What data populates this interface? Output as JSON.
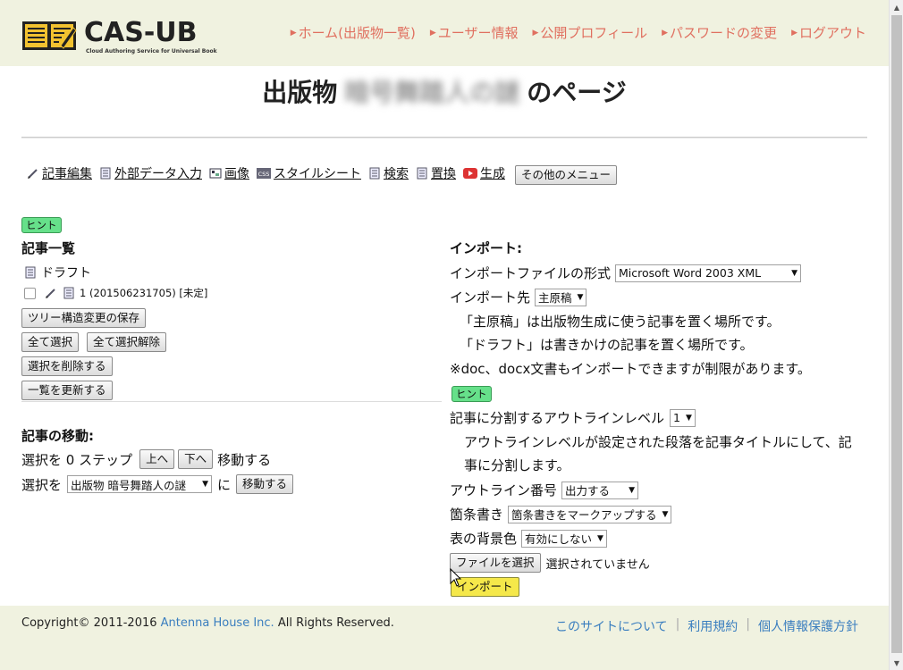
{
  "header": {
    "logo_title": "CAS-UB",
    "logo_subtitle": "Cloud Authoring Service for Universal Book",
    "nav": [
      {
        "label": "ホーム(出版物一覧)"
      },
      {
        "label": "ユーザー情報"
      },
      {
        "label": "公開プロフィール"
      },
      {
        "label": "パスワードの変更"
      },
      {
        "label": "ログアウト"
      }
    ]
  },
  "page_title": {
    "prefix": "出版物",
    "name": "暗号舞踏人の謎",
    "suffix": "のページ"
  },
  "toolbar": {
    "items": [
      {
        "label": "記事編集",
        "icon": "pencil-icon"
      },
      {
        "label": "外部データ入力",
        "icon": "document-icon"
      },
      {
        "label": "画像",
        "icon": "image-icon"
      },
      {
        "label": "スタイルシート",
        "icon": "css-icon"
      },
      {
        "label": "検索",
        "icon": "document-icon"
      },
      {
        "label": "置換",
        "icon": "document-icon"
      },
      {
        "label": "生成",
        "icon": "play-icon"
      }
    ],
    "more_menu": "その他のメニュー"
  },
  "left": {
    "hint": "ヒント",
    "articles_heading": "記事一覧",
    "draft_label": "ドラフト",
    "article_item": "1 (201506231705) [未定]",
    "save_tree": "ツリー構造変更の保存",
    "select_all": "全て選択",
    "deselect_all": "全て選択解除",
    "delete_selected": "選択を削除する",
    "refresh_list": "一覧を更新する",
    "move_heading": "記事の移動:",
    "move_row1_a": "選択を 0 ステップ",
    "up": "上へ",
    "down": "下へ",
    "move_row1_b": "移動する",
    "move_row2_a": "選択を",
    "move_target": "出版物 暗号舞踏人の謎",
    "move_row2_b": "に",
    "move_button": "移動する"
  },
  "right": {
    "import_heading": "インポート:",
    "format_label": "インポートファイルの形式",
    "format_value": "Microsoft Word 2003 XML",
    "dest_label": "インポート先",
    "dest_value": "主原稿",
    "note1": "「主原稿」は出版物生成に使う記事を置く場所です。",
    "note2": "「ドラフト」は書きかけの記事を置く場所です。",
    "note3": "※doc、docx文書もインポートできますが制限があります。",
    "hint": "ヒント",
    "outline_label": "記事に分割するアウトラインレベル",
    "outline_value": "1",
    "outline_desc1": "アウトラインレベルが設定された段落を記事タイトルにして、記",
    "outline_desc2": "事に分割します。",
    "outline_num_label": "アウトライン番号",
    "outline_num_value": "出力する",
    "bullet_label": "箇条書き",
    "bullet_value": "箇条書きをマークアップする",
    "table_bg_label": "表の背景色",
    "table_bg_value": "有効にしない",
    "choose_file": "ファイルを選択",
    "no_file": "選択されていません",
    "import_button": "インポート"
  },
  "footer": {
    "copyright_a": "Copyright© 2011-2016 ",
    "copyright_link": "Antenna House Inc.",
    "copyright_b": " All Rights Reserved.",
    "links": [
      "このサイトについて",
      "利用規約",
      "個人情報保護方針"
    ]
  },
  "colors": {
    "header_bg": "#f0f2e0",
    "nav_link": "#e07060",
    "hint_green": "#66e08a",
    "import_yellow": "#f5e84a",
    "footer_link": "#3a7ebf"
  }
}
